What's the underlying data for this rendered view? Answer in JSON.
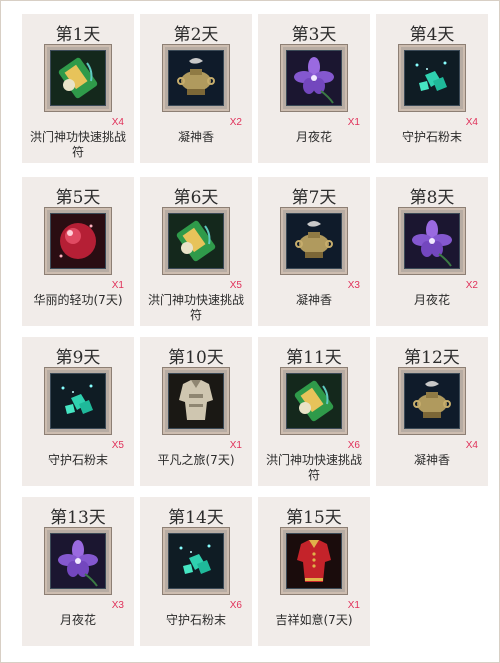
{
  "days": [
    {
      "day": "第1天",
      "name": "洪门神功快速挑战符",
      "qty": "X4",
      "icon": "talisman-icon"
    },
    {
      "day": "第2天",
      "name": "凝神香",
      "qty": "X2",
      "icon": "incense-burner-icon"
    },
    {
      "day": "第3天",
      "name": "月夜花",
      "qty": "X1",
      "icon": "violet-flower-icon"
    },
    {
      "day": "第4天",
      "name": "守护石粉末",
      "qty": "X4",
      "icon": "gem-powder-icon"
    },
    {
      "day": "第5天",
      "name": "华丽的轻功(7天)",
      "qty": "X1",
      "icon": "red-orb-icon"
    },
    {
      "day": "第6天",
      "name": "洪门神功快速挑战符",
      "qty": "X5",
      "icon": "talisman-icon"
    },
    {
      "day": "第7天",
      "name": "凝神香",
      "qty": "X3",
      "icon": "incense-burner-icon"
    },
    {
      "day": "第8天",
      "name": "月夜花",
      "qty": "X2",
      "icon": "violet-flower-icon"
    },
    {
      "day": "第9天",
      "name": "守护石粉末",
      "qty": "X5",
      "icon": "gem-powder-icon"
    },
    {
      "day": "第10天",
      "name": "平凡之旅(7天)",
      "qty": "X1",
      "icon": "armor-costume-icon"
    },
    {
      "day": "第11天",
      "name": "洪门神功快速挑战符",
      "qty": "X6",
      "icon": "talisman-icon"
    },
    {
      "day": "第12天",
      "name": "凝神香",
      "qty": "X4",
      "icon": "incense-burner-icon"
    },
    {
      "day": "第13天",
      "name": "月夜花",
      "qty": "X3",
      "icon": "violet-flower-icon"
    },
    {
      "day": "第14天",
      "name": "守护石粉末",
      "qty": "X6",
      "icon": "gem-powder-icon"
    },
    {
      "day": "第15天",
      "name": "吉祥如意(7天)",
      "qty": "X1",
      "icon": "red-costume-icon"
    }
  ]
}
